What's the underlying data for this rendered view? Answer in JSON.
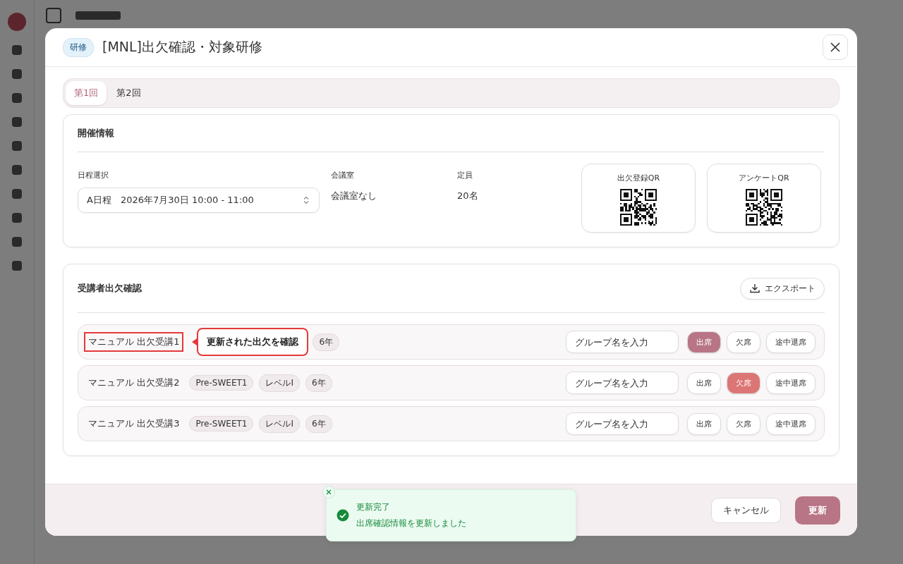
{
  "modal": {
    "badge": "研修",
    "title": "[MNL]出欠確認・対象研修"
  },
  "tabs": [
    {
      "label": "第1回",
      "selected": true
    },
    {
      "label": "第2回",
      "selected": false
    }
  ],
  "event_info": {
    "heading": "開催情報",
    "schedule_label": "日程選択",
    "schedule_value": "A日程　2026年7月30日 10:00 - 11:00",
    "room_label": "会議室",
    "room_value": "会議室なし",
    "capacity_label": "定員",
    "capacity_value": "20名",
    "qr_cards": [
      {
        "label": "出欠登録QR"
      },
      {
        "label": "アンケートQR"
      }
    ]
  },
  "attendance": {
    "heading": "受講者出欠確認",
    "export_label": "エクスポート",
    "tooltip": "更新された出欠を確認",
    "rows": [
      {
        "name": "マニュアル 出欠受講1",
        "highlighted": true,
        "show_tooltip": true,
        "tags": [
          "6年"
        ],
        "group_placeholder": "グループ名を入力",
        "options": [
          {
            "kind": "present",
            "label": "出席",
            "selected": true
          },
          {
            "kind": "absent",
            "label": "欠席",
            "selected": false
          },
          {
            "kind": "early_leave",
            "label": "途中退席",
            "selected": false
          }
        ]
      },
      {
        "name": "マニュアル 出欠受講2",
        "highlighted": false,
        "show_tooltip": false,
        "tags": [
          "Pre-SWEET1",
          "レベルI",
          "6年"
        ],
        "group_placeholder": "グループ名を入力",
        "options": [
          {
            "kind": "present",
            "label": "出席",
            "selected": false
          },
          {
            "kind": "absent",
            "label": "欠席",
            "selected": true
          },
          {
            "kind": "early_leave",
            "label": "途中退席",
            "selected": false
          }
        ]
      },
      {
        "name": "マニュアル 出欠受講3",
        "highlighted": false,
        "show_tooltip": false,
        "tags": [
          "Pre-SWEET1",
          "レベルI",
          "6年"
        ],
        "group_placeholder": "グループ名を入力",
        "options": [
          {
            "kind": "present",
            "label": "出席",
            "selected": false
          },
          {
            "kind": "absent",
            "label": "欠席",
            "selected": false
          },
          {
            "kind": "early_leave",
            "label": "途中退席",
            "selected": false
          }
        ]
      }
    ]
  },
  "toast": {
    "title": "更新完了",
    "message": "出席確認情報を更新しました"
  },
  "footer": {
    "cancel_label": "キャンセル",
    "submit_label": "更新"
  }
}
